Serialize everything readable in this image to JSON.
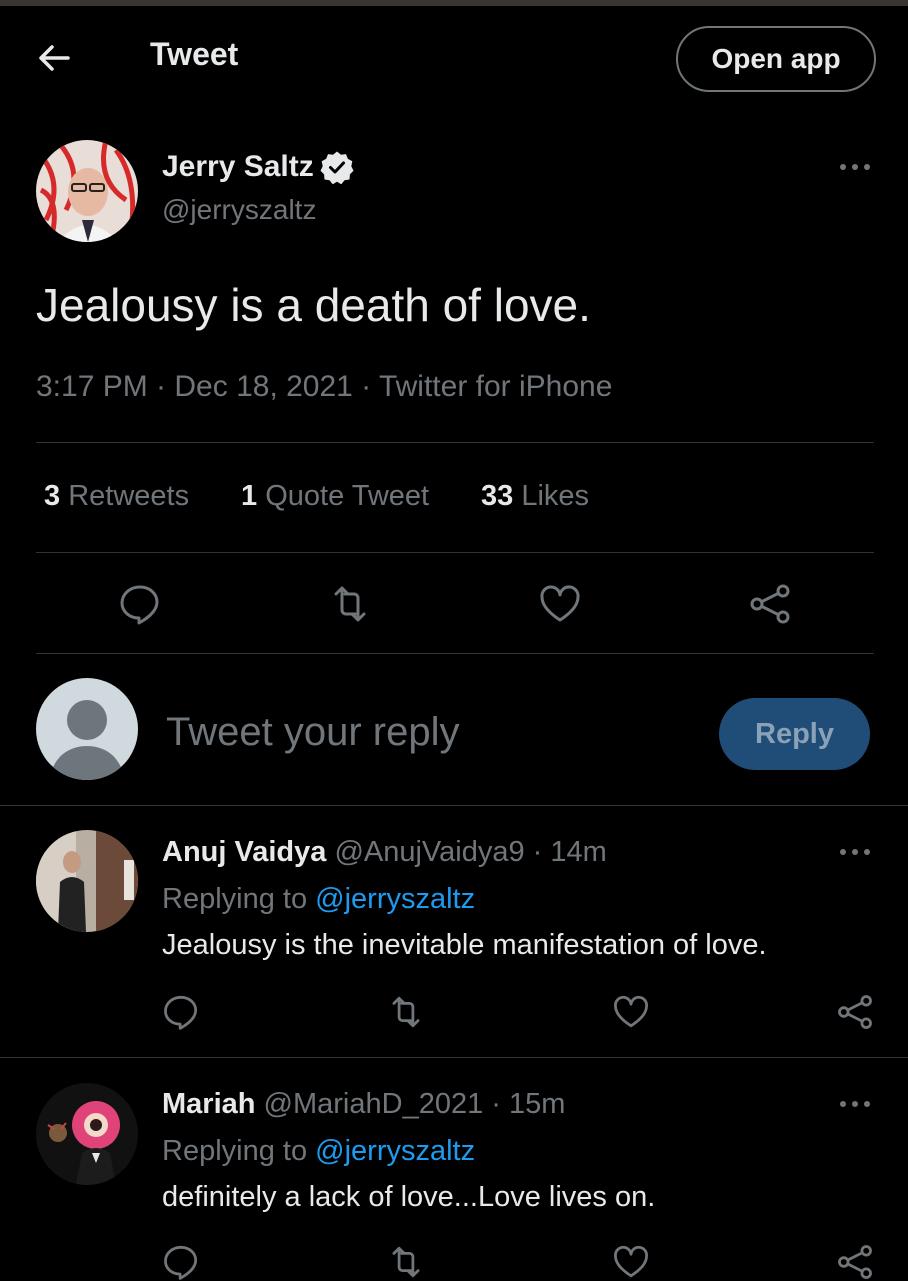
{
  "header": {
    "title": "Tweet",
    "open_app": "Open app",
    "back_icon": "arrow-left-icon"
  },
  "tweet": {
    "author_name": "Jerry Saltz",
    "verified_icon": "verified-badge-icon",
    "author_handle": "@jerryszaltz",
    "text": "Jealousy is a death of love.",
    "meta": "3:17 PM · Dec 18, 2021 · Twitter for iPhone",
    "stats": {
      "retweets_count": "3",
      "retweets_label": "Retweets",
      "quotes_count": "1",
      "quotes_label": "Quote Tweet",
      "likes_count": "33",
      "likes_label": "Likes"
    }
  },
  "composer": {
    "placeholder": "Tweet your reply",
    "reply_button": "Reply"
  },
  "replies": [
    {
      "name": "Anuj Vaidya",
      "handle": "@AnujVaidya9",
      "time": "· 14m",
      "replying_prefix": "Replying to",
      "replying_to": "@jerryszaltz",
      "text": "Jealousy is the inevitable manifestation of love."
    },
    {
      "name": "Mariah",
      "handle": "@MariahD_2021",
      "time": "· 15m",
      "replying_prefix": "Replying to",
      "replying_to": "@jerryszaltz",
      "text": "definitely a lack of love...Love lives on."
    }
  ],
  "colors": {
    "background": "#000000",
    "accent": "#1d9bf0",
    "reply_button_bg": "#1f4d78",
    "muted": "#71767b",
    "divider": "#2f3336"
  }
}
